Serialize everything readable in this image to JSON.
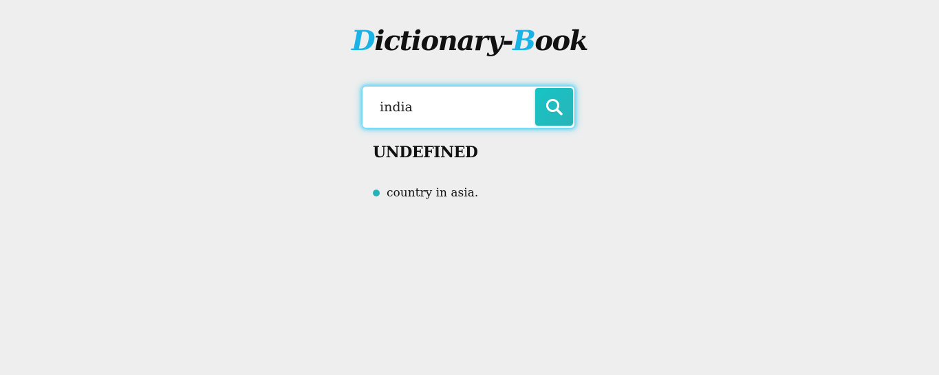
{
  "header": {
    "title_d": "D",
    "title_rest1": "ictionary-",
    "title_b": "B",
    "title_rest2": "ook"
  },
  "search": {
    "value": "india",
    "button_icon": "search-icon"
  },
  "result": {
    "word": "UNDEFINED",
    "definitions": [
      "country in asia."
    ]
  },
  "colors": {
    "accent": "#1ab3e8",
    "button": "#1fbcbf",
    "bullet": "#23b2b8",
    "background": "#eeeeee"
  }
}
